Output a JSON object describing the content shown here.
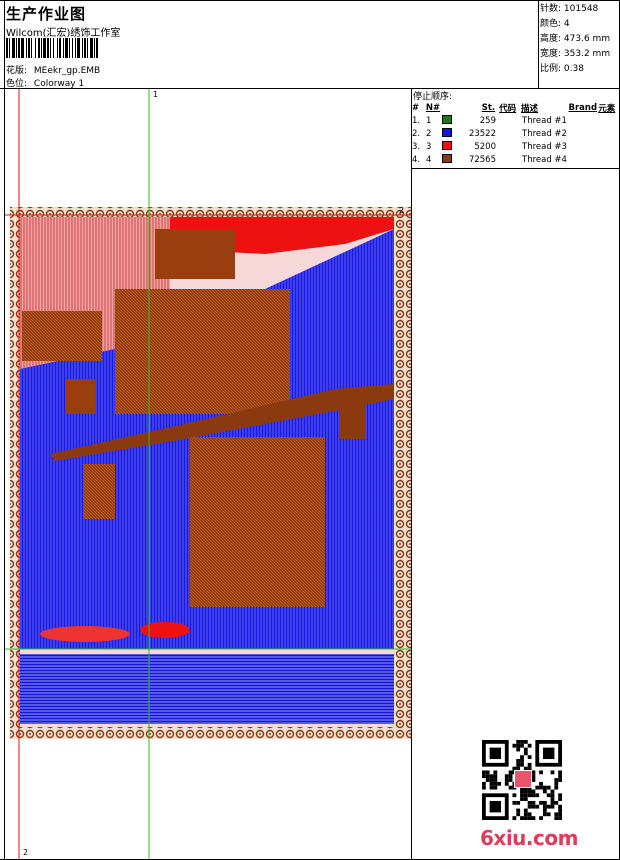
{
  "header": {
    "title": "生产作业图",
    "company": "Wilcom(汇宏)绣饰工作室",
    "design_label": "花版:",
    "design_value": "MEekr_gp.EMB",
    "colorway_label": "色位:",
    "colorway_value": "Colorway 1"
  },
  "stats": [
    {
      "label": "针数:",
      "value": "101548"
    },
    {
      "label": "颜色:",
      "value": "4"
    },
    {
      "label": "高度:",
      "value": "473.6 mm"
    },
    {
      "label": "宽度:",
      "value": "353.2 mm"
    },
    {
      "label": "比例:",
      "value": "0.38"
    }
  ],
  "thread_sequence": {
    "title": "停止顺序:",
    "columns": {
      "hash": "#",
      "n": "N#",
      "st": "St.",
      "code": "代码",
      "desc": "描述",
      "brand": "Brand",
      "element": "元素"
    },
    "rows": [
      {
        "idx": "1.",
        "n": "1",
        "color": "#1a7a1a",
        "st": "259",
        "desc": "Thread #1"
      },
      {
        "idx": "2.",
        "n": "2",
        "color": "#1414e6",
        "st": "23522",
        "desc": "Thread #2"
      },
      {
        "idx": "3.",
        "n": "3",
        "color": "#ee1111",
        "st": "5200",
        "desc": "Thread #3"
      },
      {
        "idx": "4.",
        "n": "4",
        "color": "#8b3a10",
        "st": "72565",
        "desc": "Thread #4"
      }
    ]
  },
  "rulers": {
    "v1": "1",
    "v2": "2",
    "h2": "2"
  },
  "watermark": "6xiu.com"
}
